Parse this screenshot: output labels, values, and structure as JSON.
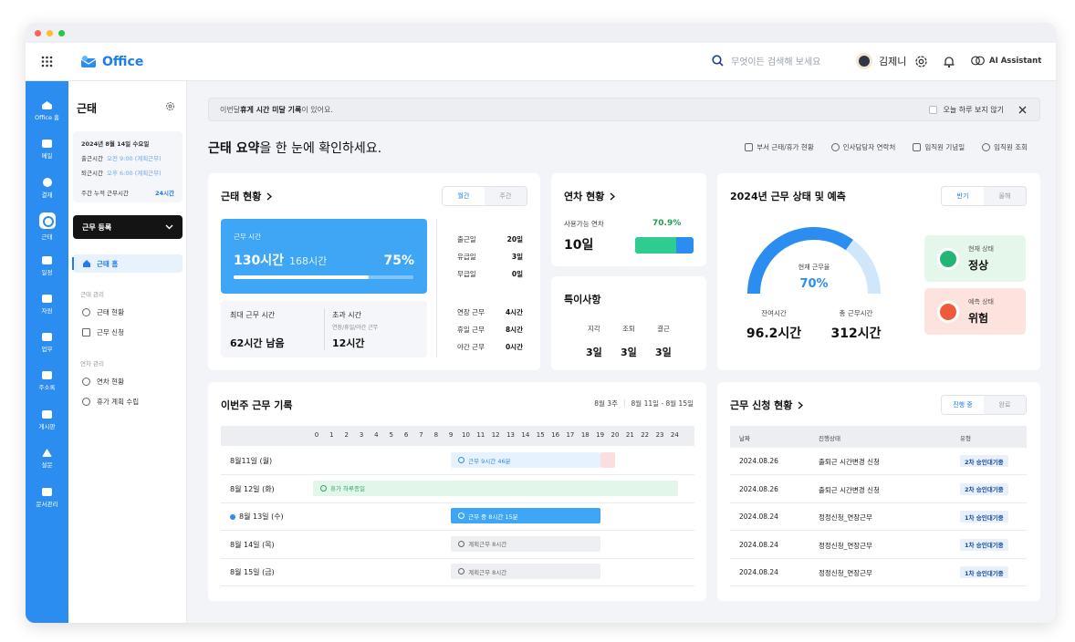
{
  "app": {
    "title": "Office"
  },
  "search": {
    "placeholder": "무엇이든 검색해 보세요"
  },
  "user": {
    "name": "김제니"
  },
  "ai": {
    "label": "AI Assistant"
  },
  "rail": [
    {
      "label": "Office 홈",
      "icon": "home-icon"
    },
    {
      "label": "메일",
      "icon": "mail-icon"
    },
    {
      "label": "결재",
      "icon": "approval-icon"
    },
    {
      "label": "근태",
      "icon": "clock-icon"
    },
    {
      "label": "일정",
      "icon": "calendar-icon"
    },
    {
      "label": "자원",
      "icon": "car-icon"
    },
    {
      "label": "업무",
      "icon": "task-icon"
    },
    {
      "label": "주소록",
      "icon": "contacts-icon"
    },
    {
      "label": "게시판",
      "icon": "board-icon"
    },
    {
      "label": "설문",
      "icon": "survey-icon"
    },
    {
      "label": "문서관리",
      "icon": "folder-icon"
    }
  ],
  "sidebar": {
    "title": "근태",
    "info": {
      "date": "2024년 8월 14일 수요일",
      "checkin_label": "출근시간",
      "checkin_value": "오전 9:00 (계획근무)",
      "checkout_label": "퇴근시간",
      "checkout_value": "오후 6:00 (계획근무)",
      "weekly_label": "주간 누적 근무시간",
      "weekly_value": "24시간"
    },
    "register_button": "근무 등록",
    "active_item": "근태 홈",
    "sections": [
      {
        "title": "근태 관리",
        "items": [
          "근태 현황",
          "근무 신청"
        ]
      },
      {
        "title": "연차 관리",
        "items": [
          "연차 현황",
          "휴가 계획 수립"
        ]
      }
    ]
  },
  "notice": {
    "prefix": "이번달 ",
    "bold": "휴게 시간 미달 기록",
    "suffix": "이 있어요.",
    "dismiss_label": "오늘 하루 보지 않기"
  },
  "headline": {
    "bold": "근태 요약",
    "rest": "을 한 눈에 확인하세요."
  },
  "quick_links": [
    "부서 근태/휴가 현황",
    "인사담당자 연락처",
    "임직원 기념일",
    "임직원 조회"
  ],
  "status_card": {
    "title": "근태 현황",
    "tabs": [
      "월간",
      "주간"
    ],
    "work_label": "근무 시간",
    "work_value": "130시간",
    "work_total": "168시간",
    "work_percent": "75%",
    "work_fraction": 0.75,
    "max_label": "최대 근무 시간",
    "max_value": "62시간 남음",
    "over_label": "초과 시간",
    "over_sub": "연장/휴일/야간 근무",
    "over_value": "12시간",
    "stats_top": [
      {
        "label": "출근일",
        "value": "20일"
      },
      {
        "label": "유급일",
        "value": "3일"
      },
      {
        "label": "무급일",
        "value": "0일"
      }
    ],
    "stats_bottom": [
      {
        "label": "연장 근무",
        "value": "4시간"
      },
      {
        "label": "휴일 근무",
        "value": "8시간"
      },
      {
        "label": "야간 근무",
        "value": "0시간"
      }
    ]
  },
  "annual_card": {
    "title": "연차 현황",
    "available_label": "사용가능 연차",
    "available_value": "10일",
    "available_percent": "70.9%",
    "available_fraction": 0.709
  },
  "special_card": {
    "title": "특이사항",
    "items": [
      {
        "label": "지각",
        "value": "3일"
      },
      {
        "label": "조퇴",
        "value": "3일"
      },
      {
        "label": "결근",
        "value": "3일"
      }
    ]
  },
  "forecast_card": {
    "title": "2024년 근무 상태 및 예측",
    "tabs": [
      "반기",
      "올해"
    ],
    "gauge_label": "현재 근무율",
    "gauge_value": "70%",
    "gauge_fraction": 0.7,
    "remaining_label": "잔여시간",
    "remaining_value": "96.2시간",
    "total_label": "총 근무시간",
    "total_value": "312시간",
    "current_label": "현재 상태",
    "current_value": "정상",
    "predict_label": "예측 상태",
    "predict_value": "위험",
    "colors": {
      "normal_bg": "#e5f7ea",
      "normal_icon": "#22b573",
      "danger_bg": "#fde3dd",
      "danger_icon": "#ef5a3c"
    }
  },
  "week_card": {
    "title": "이번주 근무 기록",
    "week_label": "8월 3주",
    "range_label": "8월 11일 - 8월 15일",
    "ticks": [
      "0",
      "1",
      "2",
      "3",
      "4",
      "5",
      "6",
      "7",
      "8",
      "9",
      "10",
      "11",
      "12",
      "13",
      "14",
      "15",
      "16",
      "17",
      "18",
      "19",
      "20",
      "21",
      "22",
      "23",
      "24"
    ],
    "rows": [
      {
        "day": "8월11일 (월)",
        "today": false,
        "label": "근무 9시간 46분",
        "start": 9,
        "end": 19,
        "overflow_end": 20,
        "style": "worked"
      },
      {
        "day": "8월 12일 (화)",
        "today": false,
        "label": "휴가 하루종일",
        "start": 0,
        "end": 24,
        "style": "leave"
      },
      {
        "day": "8월 13일 (수)",
        "today": true,
        "label": "근무 중 8시간 15분",
        "start": 9,
        "end": 19,
        "style": "working"
      },
      {
        "day": "8월 14일 (목)",
        "today": false,
        "label": "계획근무 8시간",
        "start": 9,
        "end": 19,
        "style": "planned"
      },
      {
        "day": "8월 15일 (금)",
        "today": false,
        "label": "계획근무 8시간",
        "start": 9,
        "end": 19,
        "style": "planned"
      }
    ]
  },
  "request_card": {
    "title": "근무 신청 현황",
    "tabs": [
      "진행 중",
      "완료"
    ],
    "columns": [
      "날짜",
      "진행상태",
      "유형"
    ],
    "rows": [
      {
        "date": "2024.08.26",
        "status": "출퇴근 시간변경 신청",
        "type": "2차 승인대기중"
      },
      {
        "date": "2024.08.26",
        "status": "출퇴근 시간변경 신청",
        "type": "2차 승인대기중"
      },
      {
        "date": "2024.08.24",
        "status": "정정신청_연장근무",
        "type": "1차 승인대기중"
      },
      {
        "date": "2024.08.24",
        "status": "정정신청_연장근무",
        "type": "1차 승인대기중"
      },
      {
        "date": "2024.08.24",
        "status": "정정신청_연장근무",
        "type": "1차 승인대기중"
      }
    ]
  }
}
